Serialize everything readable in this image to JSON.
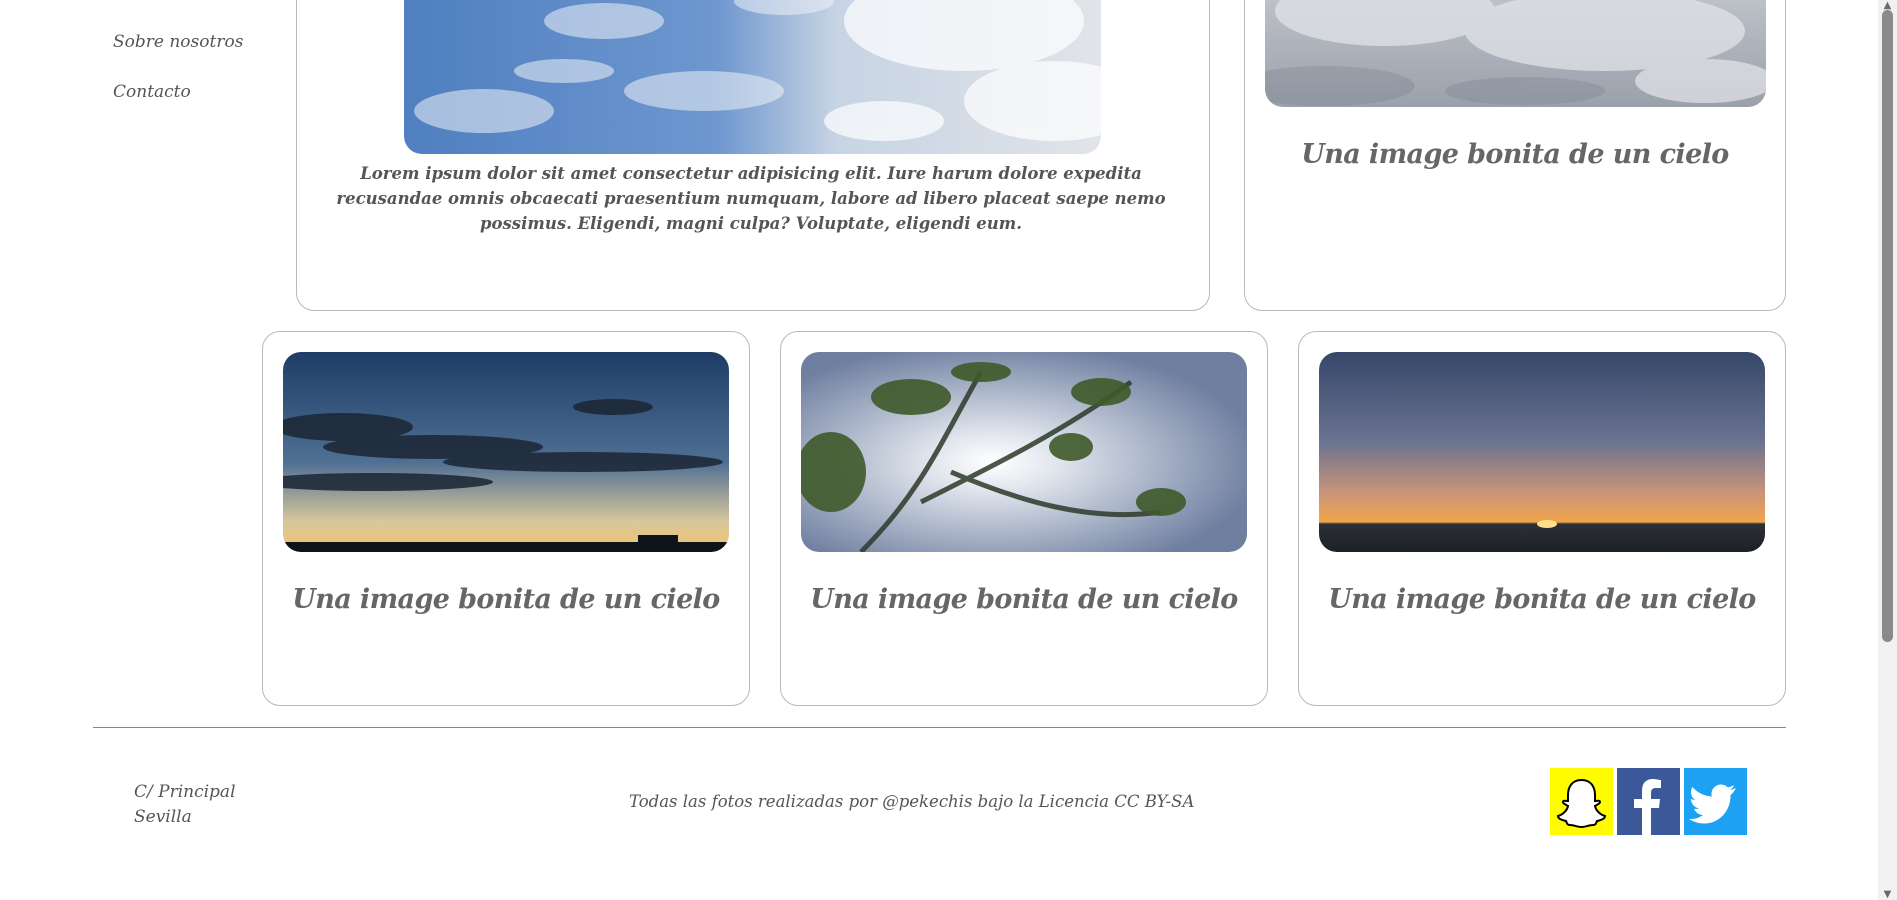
{
  "sidebar": {
    "items": [
      {
        "label": "Sobre nosotros"
      },
      {
        "label": "Contacto"
      }
    ]
  },
  "cards": {
    "featured": {
      "image_alt": "cielo azul con nubes",
      "text": "Lorem ipsum dolor sit amet consectetur adipisicing elit. Iure harum dolore expedita recusandae omnis obcaecati praesentium numquam, labore ad libero placeat saepe nemo possimus. Eligendi, magni culpa? Voluptate, eligendi eum."
    },
    "top_right": {
      "title": "Una image bonita de un cielo"
    },
    "grid": [
      {
        "title": "Una image bonita de un cielo"
      },
      {
        "title": "Una image bonita de un cielo"
      },
      {
        "title": "Una image bonita de un cielo"
      }
    ]
  },
  "footer": {
    "address_line1": "C/ Principal",
    "address_line2": "Sevilla",
    "credits": "Todas las fotos realizadas por @pekechis bajo  la Licencia CC BY-SA",
    "social": [
      {
        "name": "snapchat-icon",
        "color": "#fffc00"
      },
      {
        "name": "facebook-icon",
        "color": "#3b5998"
      },
      {
        "name": "twitter-icon",
        "color": "#1da1f2"
      }
    ]
  }
}
